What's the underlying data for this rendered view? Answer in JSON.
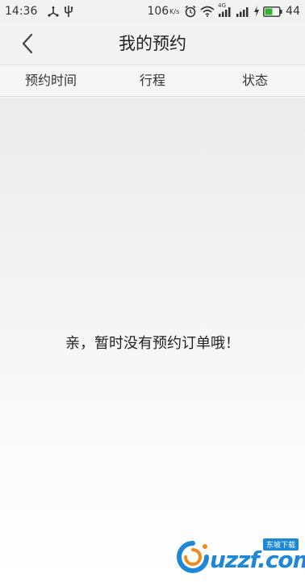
{
  "status_bar": {
    "time": "14:36",
    "network_speed": "106",
    "network_speed_unit": "K/s",
    "signal_tag": "4G",
    "battery_level": "44",
    "icons": [
      "usb-icon",
      "usb-debug-icon",
      "alarm-icon",
      "wifi-icon",
      "signal-icon",
      "charging-icon",
      "battery-icon"
    ]
  },
  "header": {
    "title": "我的预约",
    "back_icon": "chevron-left-icon"
  },
  "columns": {
    "time": "预约时间",
    "trip": "行程",
    "status": "状态"
  },
  "empty_state": {
    "message": "亲，暂时没有预约订单哦！"
  },
  "watermark": {
    "text": "uzzf.com",
    "tag": "东坡下载"
  },
  "colors": {
    "header_bg": "#f3f3f3",
    "watermark_blue": "#1e88d6",
    "battery_green": "#2fb52f"
  }
}
